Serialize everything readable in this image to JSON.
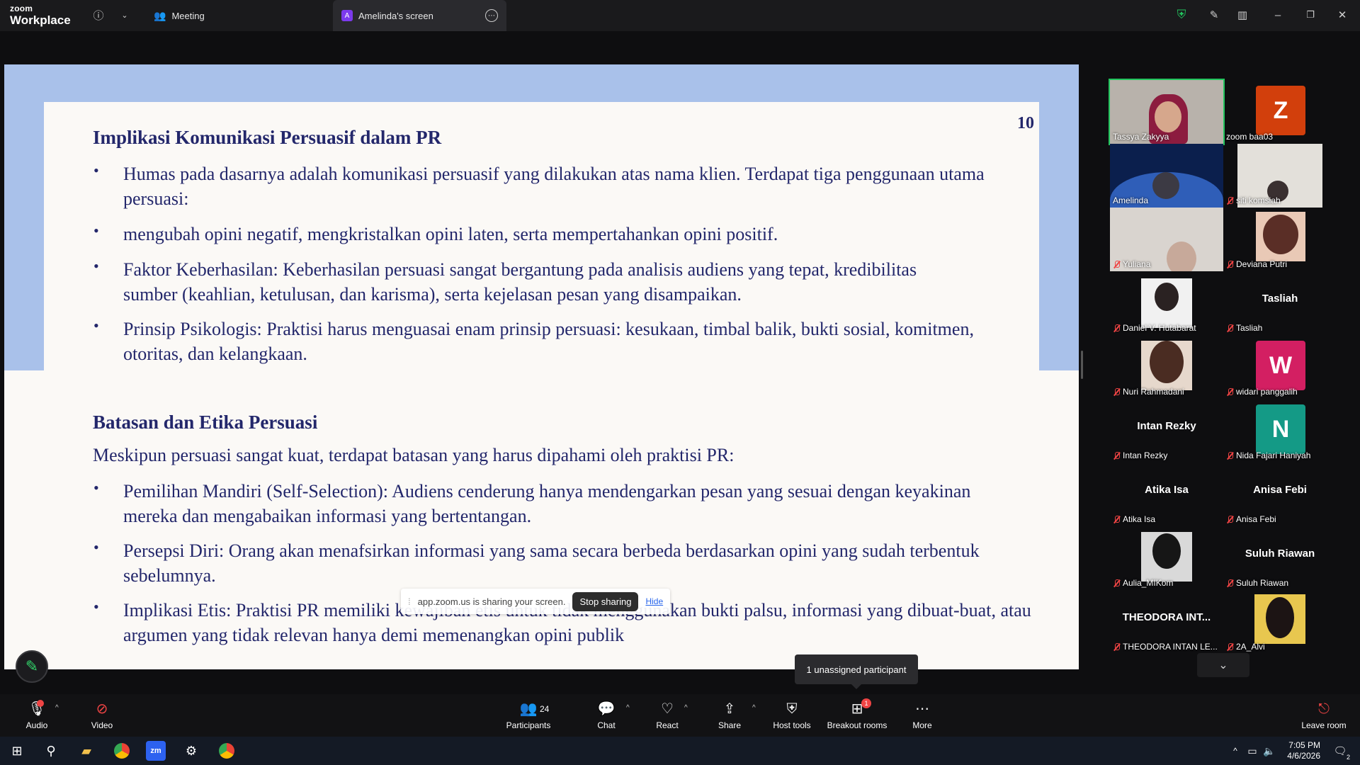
{
  "app": {
    "brand_top": "zoom",
    "brand_bottom": "Workplace"
  },
  "tabs": [
    {
      "label": "Meeting",
      "icon": "participants-icon"
    },
    {
      "label": "Amelinda's screen",
      "avatar_letter": "A"
    }
  ],
  "slide": {
    "page_number": "10",
    "heading1": "Implikasi Komunikasi Persuasif dalam PR",
    "bullets1": [
      "Humas pada dasarnya adalah komunikasi persuasif yang dilakukan atas nama klien. Terdapat tiga penggunaan utama persuasi:",
      "mengubah opini negatif, mengkristalkan opini laten, serta mempertahankan opini positif.",
      "Faktor Keberhasilan: Keberhasilan persuasi sangat bergantung pada analisis audiens yang tepat, kredibilitas sumber (keahlian, ketulusan, dan karisma), serta kejelasan pesan yang disampaikan.",
      "Prinsip Psikologis: Praktisi harus menguasai enam prinsip persuasi: kesukaan, timbal balik, bukti sosial, komitmen, otoritas, dan kelangkaan."
    ],
    "heading2": "Batasan dan Etika Persuasi",
    "intro2": "Meskipun persuasi sangat kuat, terdapat batasan yang harus dipahami oleh praktisi PR:",
    "bullets2": [
      "Pemilihan Mandiri (Self-Selection): Audiens cenderung hanya mendengarkan pesan yang sesuai dengan keyakinan mereka dan mengabaikan informasi yang bertentangan.",
      "Persepsi Diri: Orang akan menafsirkan informasi yang sama secara berbeda berdasarkan opini yang sudah terbentuk sebelumnya.",
      "Implikasi Etis: Praktisi PR memiliki kewajiban etis untuk tidak menggunakan bukti palsu, informasi yang dibuat-buat, atau argumen yang tidak relevan hanya demi memenangkan opini publik"
    ]
  },
  "share_bar": {
    "message": "app.zoom.us is sharing your screen.",
    "stop_label": "Stop sharing",
    "hide_label": "Hide"
  },
  "participants": [
    {
      "name": "Tassya Zakyya",
      "muted": false,
      "type": "video"
    },
    {
      "name": "zoom baa03",
      "muted": false,
      "type": "letter",
      "letter": "Z",
      "color": "#d23f0c"
    },
    {
      "name": "Amelinda",
      "muted": false,
      "type": "video"
    },
    {
      "name": "siti komsiah",
      "muted": true,
      "type": "video"
    },
    {
      "name": "Yuliana",
      "muted": true,
      "type": "video"
    },
    {
      "name": "Deviana Putri",
      "muted": true,
      "type": "photo"
    },
    {
      "name": "Daniel V. Hutabarat",
      "muted": true,
      "type": "photo"
    },
    {
      "name": "Tasliah",
      "muted": true,
      "type": "text",
      "display": "Tasliah"
    },
    {
      "name": "Nuri Rahmadani",
      "muted": true,
      "type": "photo"
    },
    {
      "name": "widari panggalih",
      "muted": true,
      "type": "letter",
      "letter": "W",
      "color": "#d31f62"
    },
    {
      "name": "Intan Rezky",
      "muted": true,
      "type": "text",
      "display": "Intan Rezky"
    },
    {
      "name": "Nida Fajari Haniyah",
      "muted": true,
      "type": "letter",
      "letter": "N",
      "color": "#149a86"
    },
    {
      "name": "Atika Isa",
      "muted": true,
      "type": "text",
      "display": "Atika Isa"
    },
    {
      "name": "Anisa Febi",
      "muted": true,
      "type": "text",
      "display": "Anisa Febi"
    },
    {
      "name": "Aulia_MIKom",
      "muted": true,
      "type": "photo"
    },
    {
      "name": "Suluh Riawan",
      "muted": true,
      "type": "text",
      "display": "Suluh Riawan"
    },
    {
      "name": "THEODORA INTAN LE...",
      "muted": true,
      "type": "text",
      "display": "THEODORA INT..."
    },
    {
      "name": "2A_Alvi",
      "muted": true,
      "type": "photo"
    }
  ],
  "tooltip": "1 unassigned participant",
  "toolbar": {
    "audio": "Audio",
    "video": "Video",
    "participants": "Participants",
    "participants_count": "24",
    "chat": "Chat",
    "react": "React",
    "share": "Share",
    "host_tools": "Host tools",
    "breakout_rooms": "Breakout rooms",
    "breakout_badge": "1",
    "more": "More",
    "leave": "Leave room"
  },
  "taskbar": {
    "time": "7:05 PM",
    "date": "4/6/2026",
    "notifications": "2"
  },
  "colors": {
    "accent_green": "#22c55e",
    "slide_text": "#23276b",
    "slide_band": "#a9c1ea",
    "muted_red": "#ef4444"
  }
}
